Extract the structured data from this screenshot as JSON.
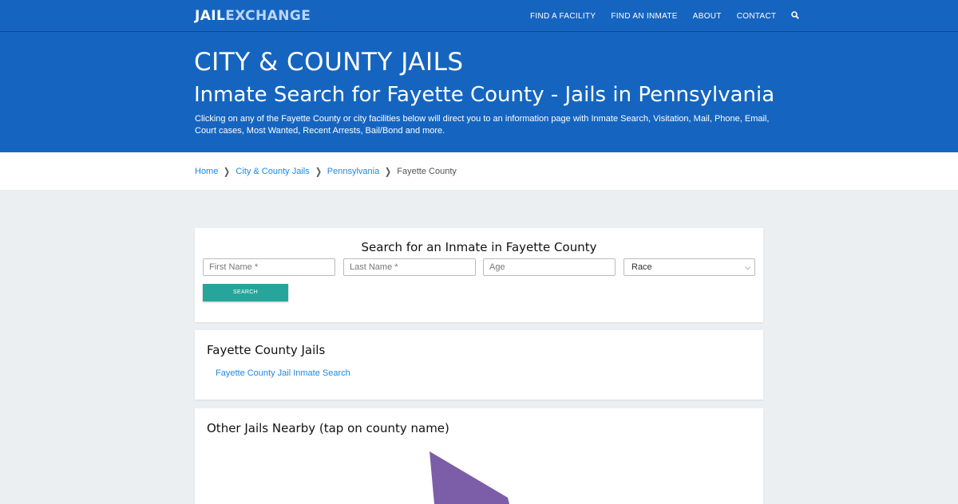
{
  "header": {
    "logo_part1": "JAIL",
    "logo_part2": "EXCHANGE",
    "nav": [
      "FIND A FACILITY",
      "FIND AN INMATE",
      "ABOUT",
      "CONTACT"
    ],
    "search_icon": "search-icon"
  },
  "hero": {
    "kicker": "CITY & COUNTY JAILS",
    "title": "Inmate Search for Fayette County - Jails in Pennsylvania",
    "description": "Clicking on any of the Fayette County or city facilities below will direct you to an information page with Inmate Search, Visitation, Mail, Phone, Email, Court cases, Most Wanted, Recent Arrests, Bail/Bond and more."
  },
  "breadcrumb": [
    "Home",
    "City & County Jails",
    "Pennsylvania",
    "Fayette County"
  ],
  "search_form": {
    "title": "Search for an Inmate in Fayette County",
    "first_name_placeholder": "First Name *",
    "last_name_placeholder": "Last Name *",
    "age_placeholder": "Age",
    "race_selected": "Race",
    "button_label": "SEARCH"
  },
  "county_jails": {
    "title": "Fayette County Jails",
    "links": [
      "Fayette County Jail Inmate Search"
    ]
  },
  "nearby": {
    "title": "Other Jails Nearby (tap on county name)",
    "map_color": "#7b5ea7"
  },
  "colors": {
    "primary": "#1565c0",
    "link": "#1e88e5",
    "button": "#26a69a",
    "background": "#eceff1"
  }
}
